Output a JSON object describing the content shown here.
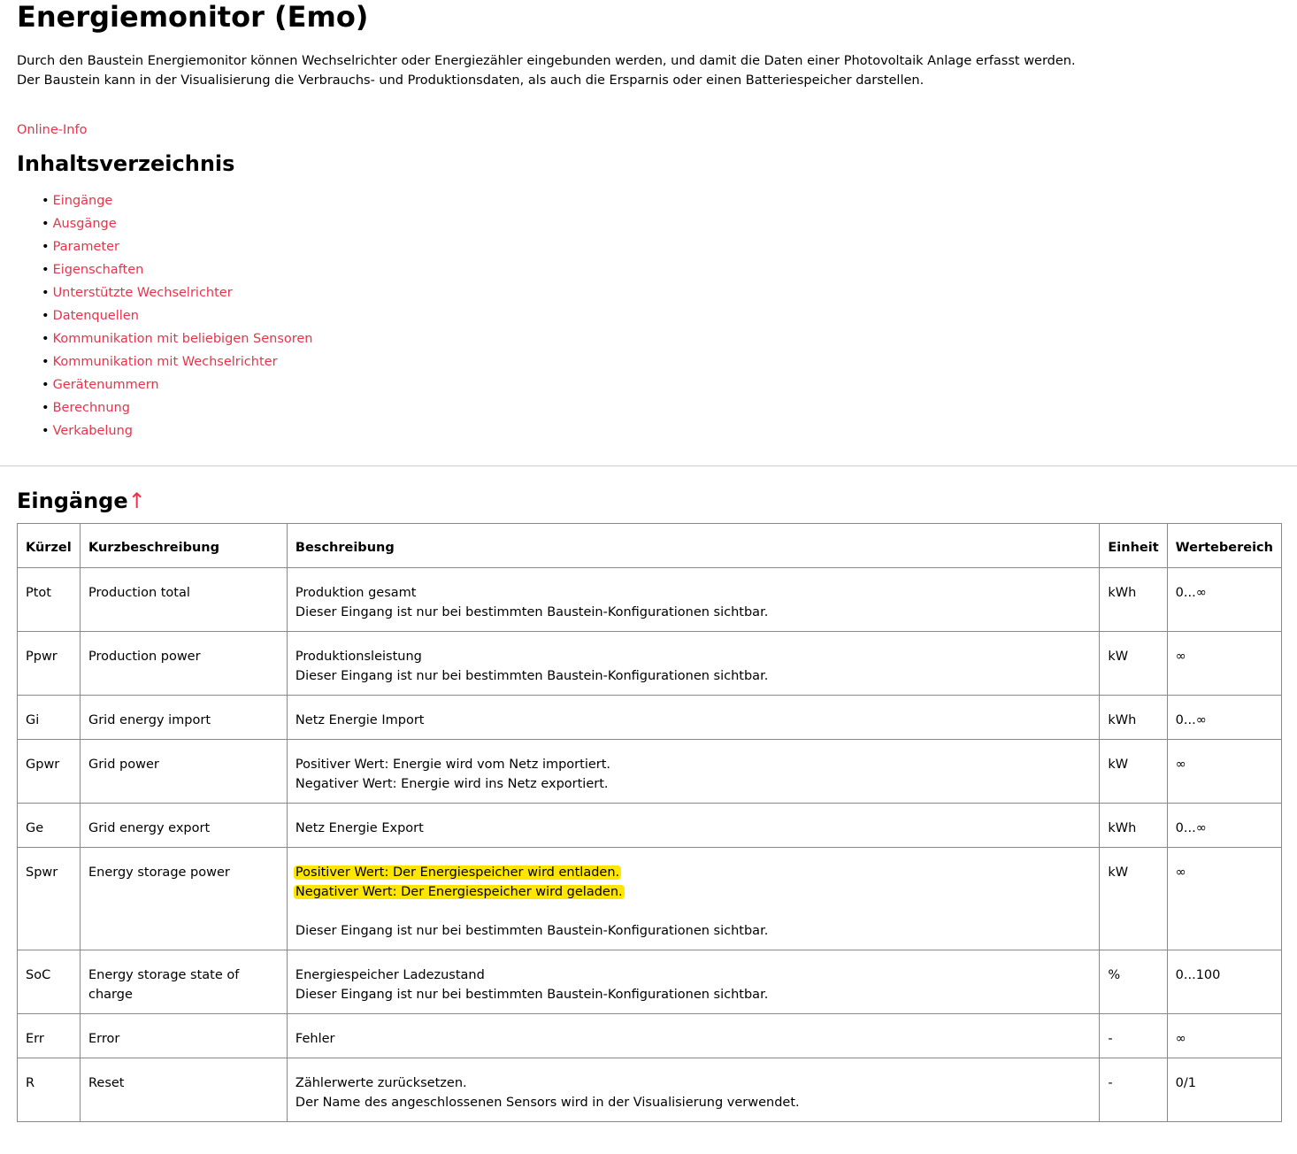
{
  "title": "Energiemonitor (Emo)",
  "intro": [
    "Durch den Baustein Energiemonitor können Wechselrichter oder Energiezähler eingebunden werden, und damit die Daten einer Photovoltaik Anlage erfasst werden.",
    "Der Baustein kann in der Visualisierung die Verbrauchs- und Produktionsdaten, als auch die Ersparnis oder einen Batteriespeicher darstellen."
  ],
  "online_info": "Online-Info",
  "toc_title": "Inhaltsverzeichnis",
  "toc": [
    "Eingänge",
    "Ausgänge",
    "Parameter",
    "Eigenschaften",
    "Unterstützte Wechselrichter",
    "Datenquellen",
    "Kommunikation mit beliebigen Sensoren",
    "Kommunikation mit Wechselrichter",
    "Gerätenummern",
    "Berechnung",
    "Verkabelung"
  ],
  "section_title": "Eingänge",
  "up_arrow": "↑",
  "link_color": "#e8334a",
  "highlight_color": "#ffe600",
  "table": {
    "headers": [
      "Kürzel",
      "Kurzbeschreibung",
      "Beschreibung",
      "Einheit",
      "Wertebereich"
    ],
    "rows": [
      {
        "k": "Ptot",
        "short": "Production total",
        "desc": [
          "Produktion gesamt",
          "Dieser Eingang ist nur bei bestimmten Baustein-Konfigurationen sichtbar."
        ],
        "unit": "kWh",
        "range": "0...∞"
      },
      {
        "k": "Ppwr",
        "short": "Production power",
        "desc": [
          "Produktionsleistung",
          "Dieser Eingang ist nur bei bestimmten Baustein-Konfigurationen sichtbar."
        ],
        "unit": "kW",
        "range": "∞"
      },
      {
        "k": "Gi",
        "short": "Grid energy import",
        "desc": [
          "Netz Energie Import"
        ],
        "unit": "kWh",
        "range": "0...∞"
      },
      {
        "k": "Gpwr",
        "short": "Grid power",
        "desc": [
          "Positiver Wert: Energie wird vom Netz importiert.",
          "Negativer Wert: Energie wird ins Netz exportiert."
        ],
        "unit": "kW",
        "range": "∞"
      },
      {
        "k": "Ge",
        "short": "Grid energy export",
        "desc": [
          "Netz Energie Export"
        ],
        "unit": "kWh",
        "range": "0...∞"
      },
      {
        "k": "Spwr",
        "short": "Energy storage power",
        "desc": [
          "Positiver Wert: Der Energiespeicher wird entladen.",
          "Negativer Wert: Der Energiespeicher wird geladen.",
          "",
          "Dieser Eingang ist nur bei bestimmten Baustein-Konfigurationen sichtbar."
        ],
        "highlight": [
          0,
          1
        ],
        "unit": "kW",
        "range": "∞"
      },
      {
        "k": "SoC",
        "short": "Energy storage state of charge",
        "desc": [
          "Energiespeicher Ladezustand",
          "Dieser Eingang ist nur bei bestimmten Baustein-Konfigurationen sichtbar."
        ],
        "unit": "%",
        "range": "0...100"
      },
      {
        "k": "Err",
        "short": "Error",
        "desc": [
          "Fehler"
        ],
        "unit": "-",
        "range": "∞"
      },
      {
        "k": "R",
        "short": "Reset",
        "desc": [
          "Zählerwerte zurücksetzen.",
          "Der Name des angeschlossenen Sensors wird in der Visualisierung verwendet."
        ],
        "unit": "-",
        "range": "0/1"
      }
    ]
  }
}
